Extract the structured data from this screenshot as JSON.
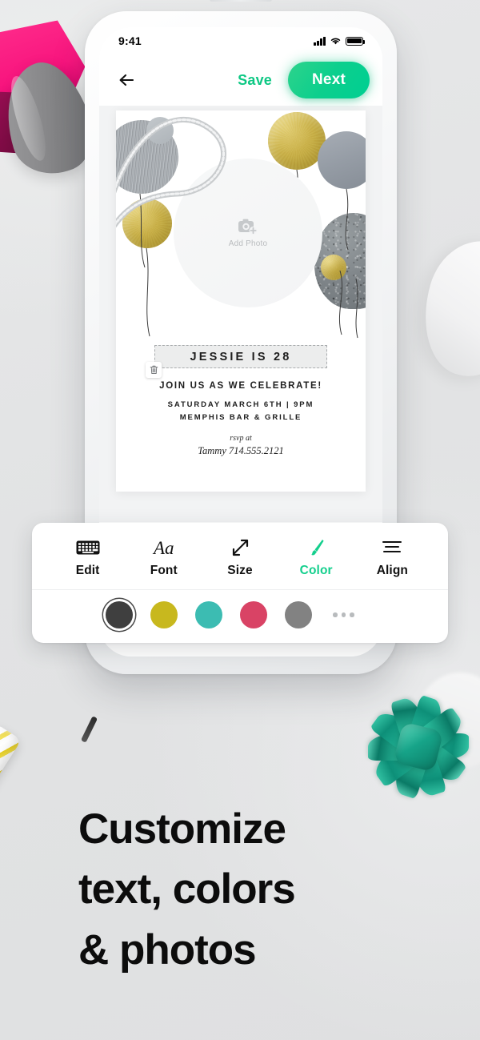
{
  "statusbar": {
    "time": "9:41",
    "signal_icon": "cellular-signal-icon",
    "wifi_icon": "wifi-icon",
    "battery_icon": "battery-icon"
  },
  "navbar": {
    "back_icon": "back-arrow-icon",
    "save_label": "Save",
    "next_label": "Next",
    "save_color": "#0ec884",
    "next_bg": "#0ccf8d"
  },
  "card": {
    "add_photo_label": "Add Photo",
    "add_photo_icon": "camera-plus-icon",
    "title": "JESSIE IS 28",
    "delete_icon": "trash-icon",
    "celebrate_line": "JOIN US AS WE CELEBRATE!",
    "when_line": "SATURDAY MARCH 6TH  |  9PM",
    "where_line": "MEMPHIS BAR & GRILLE",
    "rsvp_label": "rsvp at",
    "rsvp_name": "Tammy 714.555.2121"
  },
  "toolbar": {
    "tools": [
      {
        "label": "Edit",
        "icon": "keyboard-icon",
        "active": false
      },
      {
        "label": "Font",
        "icon": "font-aa-icon",
        "active": false
      },
      {
        "label": "Size",
        "icon": "resize-arrow-icon",
        "active": false
      },
      {
        "label": "Color",
        "icon": "paintbrush-icon",
        "active": true
      },
      {
        "label": "Align",
        "icon": "align-lines-icon",
        "active": false
      }
    ],
    "font_icon_glyph": "Aa",
    "swatches": [
      {
        "name": "charcoal",
        "hex": "#3f3f3f",
        "selected": true
      },
      {
        "name": "mustard",
        "hex": "#c8b81e",
        "selected": false
      },
      {
        "name": "teal",
        "hex": "#3cbcb2",
        "selected": false
      },
      {
        "name": "rose",
        "hex": "#d94365",
        "selected": false
      },
      {
        "name": "gray",
        "hex": "#828282",
        "selected": false
      }
    ],
    "more_icon": "more-dots-icon",
    "active_color": "#14cf8d"
  },
  "headline": {
    "line1": "Customize",
    "line2": "text, colors",
    "line3": "& photos"
  },
  "scene": {
    "background_hex": "#e2e3e4",
    "pink_bag": "pink-gift-bag",
    "teal_bow": "teal-gift-bow",
    "candle": "striped-birthday-candle"
  }
}
